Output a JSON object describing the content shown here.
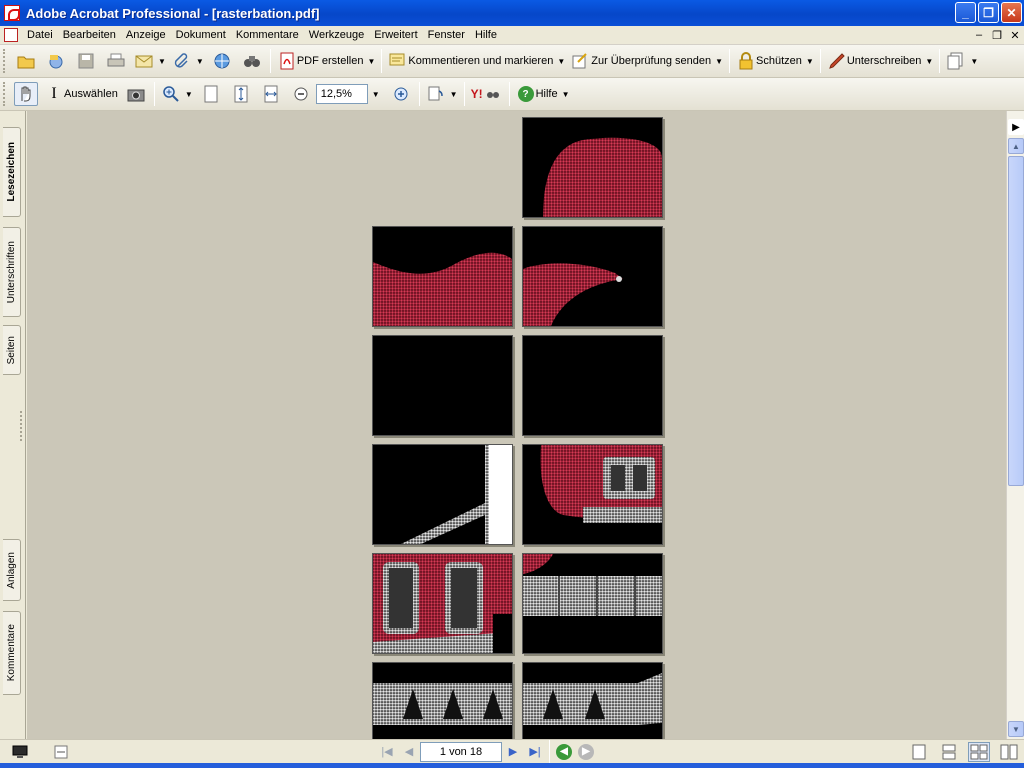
{
  "window": {
    "title": "Adobe Acrobat Professional - [rasterbation.pdf]",
    "controls": [
      "_",
      "❐",
      "✕"
    ]
  },
  "menu": {
    "items": [
      "Datei",
      "Bearbeiten",
      "Anzeige",
      "Dokument",
      "Kommentare",
      "Werkzeuge",
      "Erweitert",
      "Fenster",
      "Hilfe"
    ],
    "mdi_controls": [
      "–",
      "❐",
      "✕"
    ]
  },
  "toolbar1": {
    "pdf_erstellen": "PDF erstellen",
    "kommentieren": "Kommentieren und markieren",
    "ueberpruefung": "Zur Überprüfung senden",
    "schuetzen": "Schützen",
    "unterschreiben": "Unterschreiben"
  },
  "toolbar2": {
    "auswaehlen": "Auswählen",
    "zoom_value": "12,5%",
    "yahoo": "Y!",
    "hilfe": "Hilfe"
  },
  "left_tabs": {
    "lesezeichen": "Lesezeichen",
    "unterschriften": "Unterschriften",
    "seiten": "Seiten",
    "anlagen": "Anlagen",
    "kommentare": "Kommentare"
  },
  "statusbar": {
    "page_indicator": "1 von 18"
  },
  "document": {
    "pages_rendered": 12,
    "page_count": 18,
    "zoom_percent": 12.5
  },
  "colors": {
    "titlebar": "#0a5ae4",
    "page_bg": "#cbc7b8",
    "guitar_red": "#c42a44",
    "tile_black": "#000000"
  }
}
